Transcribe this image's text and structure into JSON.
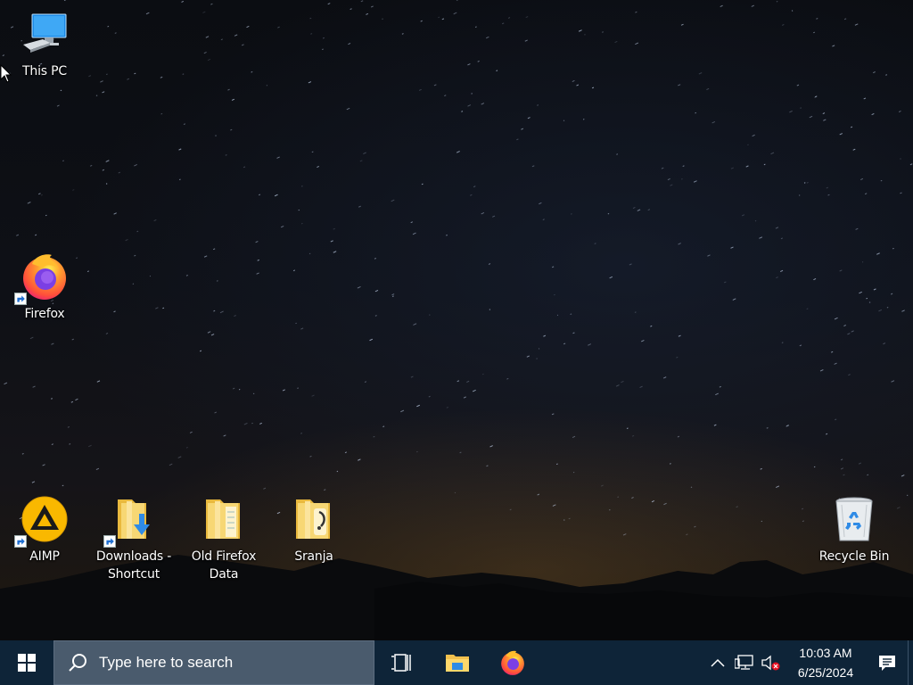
{
  "desktop": {
    "icons": [
      {
        "label": "This PC",
        "icon": "this-pc-icon"
      },
      {
        "label": "Firefox",
        "icon": "firefox-icon",
        "shortcut": true
      },
      {
        "label": "AIMP",
        "icon": "aimp-icon",
        "shortcut": true
      },
      {
        "label": "Downloads -\nShortcut",
        "icon": "downloads-folder-icon",
        "shortcut": true
      },
      {
        "label": "Old Firefox\nData",
        "icon": "folder-icon"
      },
      {
        "label": "Sranja",
        "icon": "folder-icon"
      },
      {
        "label": "Recycle Bin",
        "icon": "recycle-bin-icon"
      }
    ]
  },
  "taskbar": {
    "start_icon": "windows-logo-icon",
    "search": {
      "placeholder": "Type here to search",
      "icon": "search-icon"
    },
    "buttons": [
      {
        "name": "task-view",
        "icon": "task-view-icon"
      },
      {
        "name": "file-explorer",
        "icon": "file-explorer-icon"
      },
      {
        "name": "firefox",
        "icon": "firefox-icon"
      }
    ],
    "tray": {
      "icons": [
        "chevron-up-icon",
        "network-icon",
        "volume-muted-icon"
      ],
      "time": "10:03 AM",
      "date": "6/25/2024",
      "notification_icon": "action-center-icon"
    }
  },
  "colors": {
    "taskbar": "#0e2438",
    "search_box": "#4a5b6d",
    "firefox_orange": "#ff7139",
    "firefox_purple": "#7b3fe4",
    "aimp_yellow": "#f9b800",
    "folder_yellow": "#f5c94a",
    "windows_blue": "#ffffff"
  }
}
